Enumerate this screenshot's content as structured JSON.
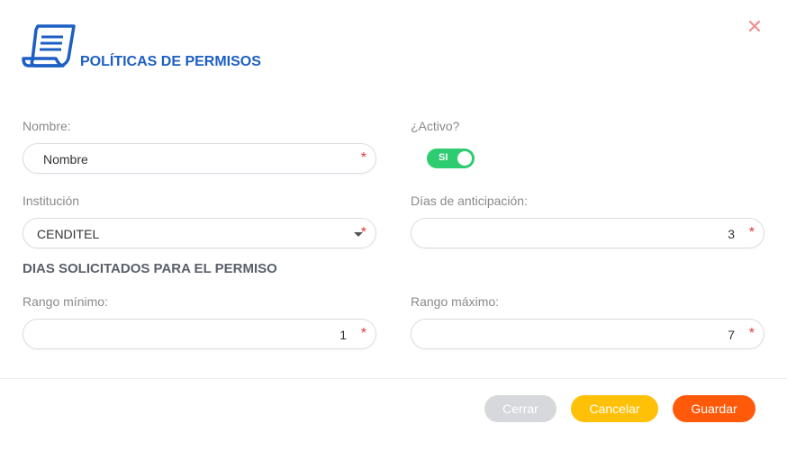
{
  "header": {
    "title": "POLÍTICAS DE PERMISOS",
    "close_icon": "close-icon",
    "document_icon": "document-icon"
  },
  "form": {
    "nombre": {
      "label": "Nombre:",
      "value": "Nombre",
      "required": "*"
    },
    "activo": {
      "label": "¿Activo?",
      "toggle_text": "SI",
      "on": true
    },
    "institucion": {
      "label": "Institución",
      "value": "CENDITEL",
      "required": "*"
    },
    "dias_anticipacion": {
      "label": "Días de anticipación:",
      "value": "3",
      "required": "*"
    },
    "section_title": "DIAS SOLICITADOS PARA EL PERMISO",
    "rango_minimo": {
      "label": "Rango mínimo:",
      "value": "1",
      "required": "*"
    },
    "rango_maximo": {
      "label": "Rango máximo:",
      "value": "7",
      "required": "*"
    }
  },
  "footer": {
    "cerrar": "Cerrar",
    "cancelar": "Cancelar",
    "guardar": "Guardar"
  },
  "colors": {
    "title": "#1c5fc4",
    "toggle_on": "#2ecc71",
    "cerrar_bg": "#d6d8dc",
    "cancelar_bg": "#ffc107",
    "guardar_bg": "#ff5a0a",
    "required": "#e53935"
  }
}
